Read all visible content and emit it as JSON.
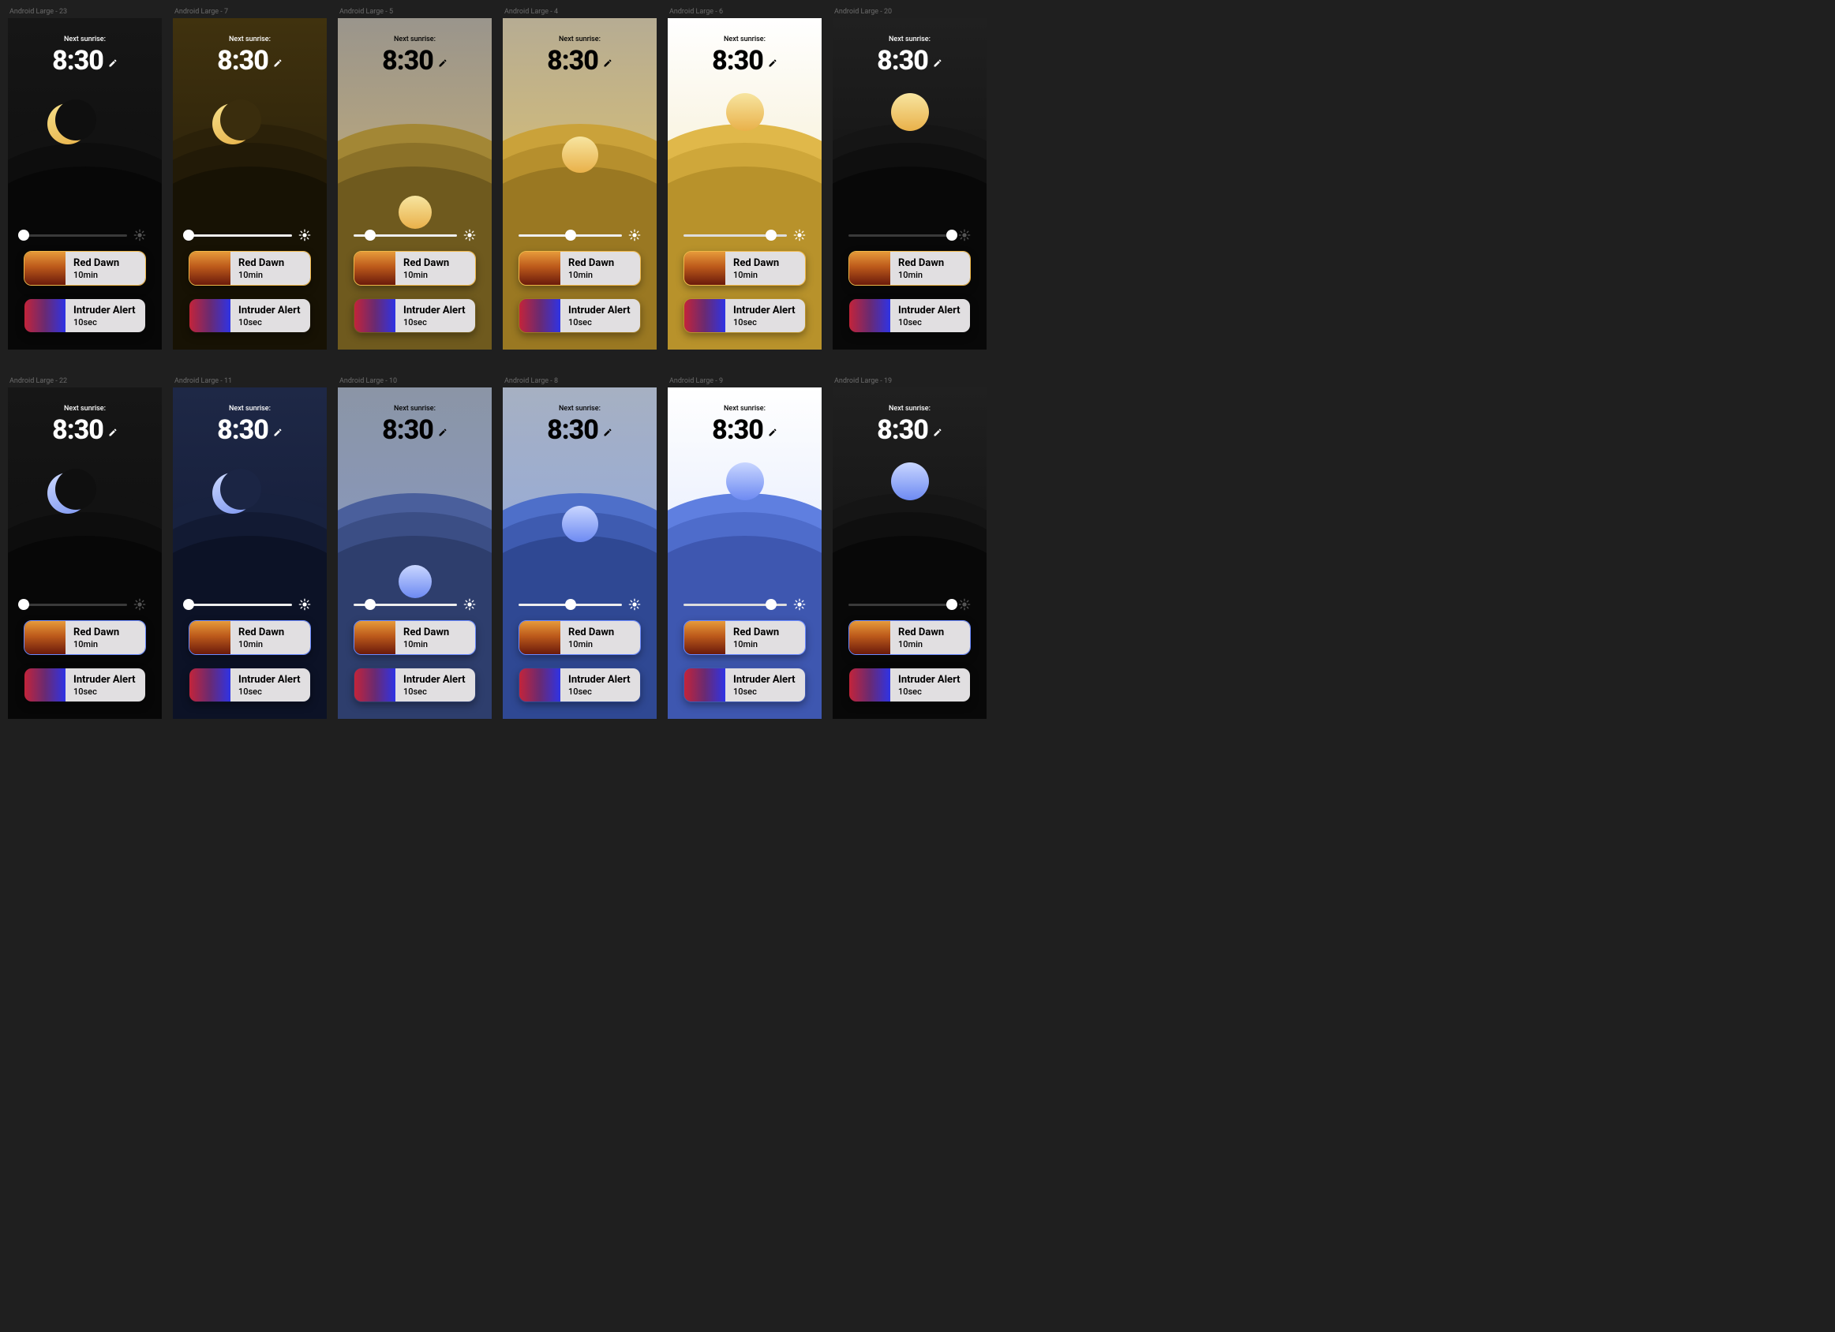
{
  "common": {
    "sunrise_label": "Next sunrise:",
    "time": "8:30",
    "preset_red_dawn_title": "Red Dawn",
    "preset_red_dawn_sub": "10min",
    "preset_intruder_title": "Intruder Alert",
    "preset_intruder_sub": "10sec"
  },
  "rows": [
    {
      "theme": "warm",
      "frames": [
        {
          "label": "Android Large - 23",
          "variant": "black",
          "slider": 0,
          "text": "white",
          "border": "#f0b848"
        },
        {
          "label": "Android Large - 7",
          "variant": "night",
          "slider": 0,
          "text": "white",
          "border": "#f0b848"
        },
        {
          "label": "Android Large - 5",
          "variant": "dawn",
          "slider": 16,
          "text": "black",
          "border": "#f0b848"
        },
        {
          "label": "Android Large - 4",
          "variant": "morning",
          "slider": 50,
          "text": "black",
          "border": "#f0b848"
        },
        {
          "label": "Android Large - 6",
          "variant": "day",
          "slider": 85,
          "text": "black",
          "border": "#f0b848"
        },
        {
          "label": "Android Large - 20",
          "variant": "black-day",
          "slider": 100,
          "text": "white",
          "border": "#f0b848"
        }
      ]
    },
    {
      "theme": "cool",
      "frames": [
        {
          "label": "Android Large - 22",
          "variant": "black",
          "slider": 0,
          "text": "white",
          "border": "#6a8aff"
        },
        {
          "label": "Android Large - 11",
          "variant": "night",
          "slider": 0,
          "text": "white",
          "border": "#6a8aff"
        },
        {
          "label": "Android Large - 10",
          "variant": "dawn",
          "slider": 16,
          "text": "black",
          "border": "#6a8aff"
        },
        {
          "label": "Android Large - 8",
          "variant": "morning",
          "slider": 50,
          "text": "black",
          "border": "#6a8aff"
        },
        {
          "label": "Android Large - 9",
          "variant": "day",
          "slider": 85,
          "text": "black",
          "border": "#6a8aff"
        },
        {
          "label": "Android Large - 19",
          "variant": "black-day",
          "slider": 100,
          "text": "white",
          "border": "#6a8aff"
        }
      ]
    }
  ],
  "palettes": {
    "warm": {
      "moon": "linear-gradient(160deg,#f6e08a 0%,#e7b24a 100%)",
      "sun": "linear-gradient(180deg,#f7e5a0 0%,#e9b14a 100%)",
      "black": {
        "sky": "linear-gradient(180deg,#161616 0%,#0a0a0a 100%)",
        "hill": [
          "#121212",
          "#0d0d0d",
          "#070707"
        ],
        "track": "#3a3a3a",
        "icon": "#555"
      },
      "black-day": {
        "sky": "linear-gradient(180deg,#202020 0%,#0a0a0a 100%)",
        "hill": [
          "#151515",
          "#0f0f0f",
          "#080808"
        ],
        "track": "#3a3a3a",
        "icon": "#555"
      },
      "night": {
        "sky": "linear-gradient(180deg,#40320e 0%,#1c1508 100%)",
        "hill": [
          "#2b2109",
          "#221a07",
          "#171204"
        ],
        "track": "#eee",
        "icon": "#fff"
      },
      "dawn": {
        "sky": "linear-gradient(180deg,#9a958c 0%,#cdb273 80%)",
        "hill": [
          "#a38735",
          "#8b7128",
          "#6f5a1e"
        ],
        "track": "#eee",
        "icon": "#fff"
      },
      "morning": {
        "sky": "linear-gradient(180deg,#b6ac93 0%,#e6c666 80%)",
        "hill": [
          "#caa23a",
          "#b68f2d",
          "#9a7822"
        ],
        "track": "#eee",
        "icon": "#fff"
      },
      "day": {
        "sky": "linear-gradient(180deg,#ffffff 0%,#f2e7bf 85%)",
        "hill": [
          "#e0b84a",
          "#cfa73a",
          "#b8922b"
        ],
        "track": "#ddd",
        "icon": "#fff"
      }
    },
    "cool": {
      "moon": "linear-gradient(160deg,#cdd9ff 0%,#7f98f0 100%)",
      "sun": "linear-gradient(180deg,#c9d6ff 0%,#6d8af2 100%)",
      "black": {
        "sky": "linear-gradient(180deg,#161616 0%,#0a0a0a 100%)",
        "hill": [
          "#121212",
          "#0d0d0d",
          "#070707"
        ],
        "track": "#3a3a3a",
        "icon": "#555"
      },
      "black-day": {
        "sky": "linear-gradient(180deg,#202020 0%,#0a0a0a 100%)",
        "hill": [
          "#151515",
          "#0f0f0f",
          "#080808"
        ],
        "track": "#3a3a3a",
        "icon": "#555"
      },
      "night": {
        "sky": "linear-gradient(180deg,#1e2846 0%,#0e1530 100%)",
        "hill": [
          "#18223f",
          "#121a33",
          "#0c1226"
        ],
        "track": "#eee",
        "icon": "#fff"
      },
      "dawn": {
        "sky": "linear-gradient(180deg,#8b95a6 0%,#8699c9 80%)",
        "hill": [
          "#4a5f9c",
          "#3b4e85",
          "#2e3e6d"
        ],
        "track": "#eee",
        "icon": "#fff"
      },
      "morning": {
        "sky": "linear-gradient(180deg,#a6b0c2 0%,#8da8e6 80%)",
        "hill": [
          "#4e6fc9",
          "#3e5bb0",
          "#2f4893"
        ],
        "track": "#eee",
        "icon": "#fff"
      },
      "day": {
        "sky": "linear-gradient(180deg,#ffffff 0%,#d8e2fb 85%)",
        "hill": [
          "#5f7fe0",
          "#4e6ccb",
          "#3e57b0"
        ],
        "track": "#ddd",
        "icon": "#fff"
      }
    }
  }
}
